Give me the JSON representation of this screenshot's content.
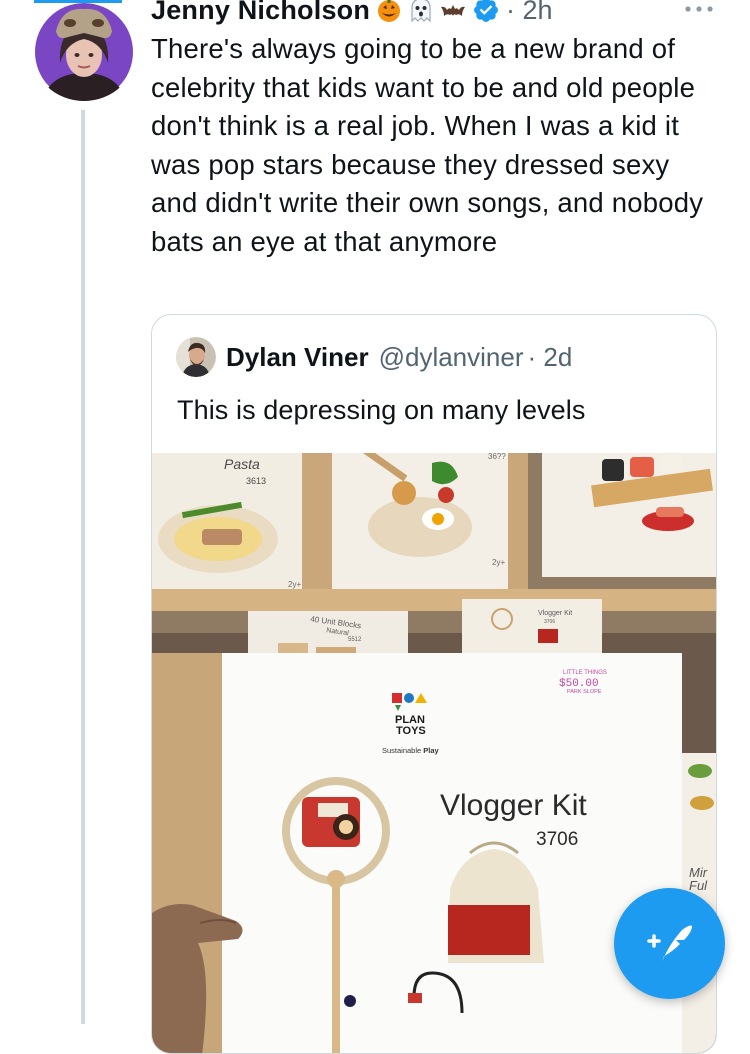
{
  "tweet": {
    "author_name": "Jenny Nicholson",
    "author_emojis": [
      "jack-o-lantern-icon",
      "ghost-icon",
      "bat-icon"
    ],
    "timestamp": "· 2h",
    "text": "There's always going to be a new brand of celebrity that kids want to be and old people don't think is a real job. When I was a kid it was pop stars because they dressed sexy and didn't write their own songs, and nobody bats an eye at that anymore"
  },
  "quote": {
    "author_name": "Dylan Viner",
    "handle": "@dylanviner",
    "timestamp": "· 2d",
    "text": "This is depressing on many levels"
  },
  "media": {
    "shelf_box_1": {
      "title": "Pasta",
      "number": "3613",
      "age": "2y+"
    },
    "shelf_box_2": {
      "number": "36??",
      "age": "2y+"
    },
    "lower_box_1": {
      "title": "40 Unit Blocks",
      "subtitle": "Natural",
      "number": "5512"
    },
    "lower_box_2": {
      "title": "Vlogger Kit",
      "number": "3706"
    },
    "product": {
      "brand_line1": "PLAN",
      "brand_line2": "TOYS",
      "tagline_prefix": "Sustainable ",
      "tagline_bold": "Play",
      "title": "Vlogger Kit",
      "number": "3706",
      "price_store": "LITTLE THINGS",
      "price": "$50.00",
      "price_location": "PARK SLOPE"
    },
    "side_box": {
      "line1": "Mir",
      "line2": "Ful"
    }
  },
  "colors": {
    "accent": "#1d9bf0",
    "secondary_text": "#536471",
    "border": "#cfd9de",
    "verified": "#1d9bf0",
    "bag_red": "#b7261f"
  },
  "fab": {
    "icon": "compose-tweet-icon"
  }
}
